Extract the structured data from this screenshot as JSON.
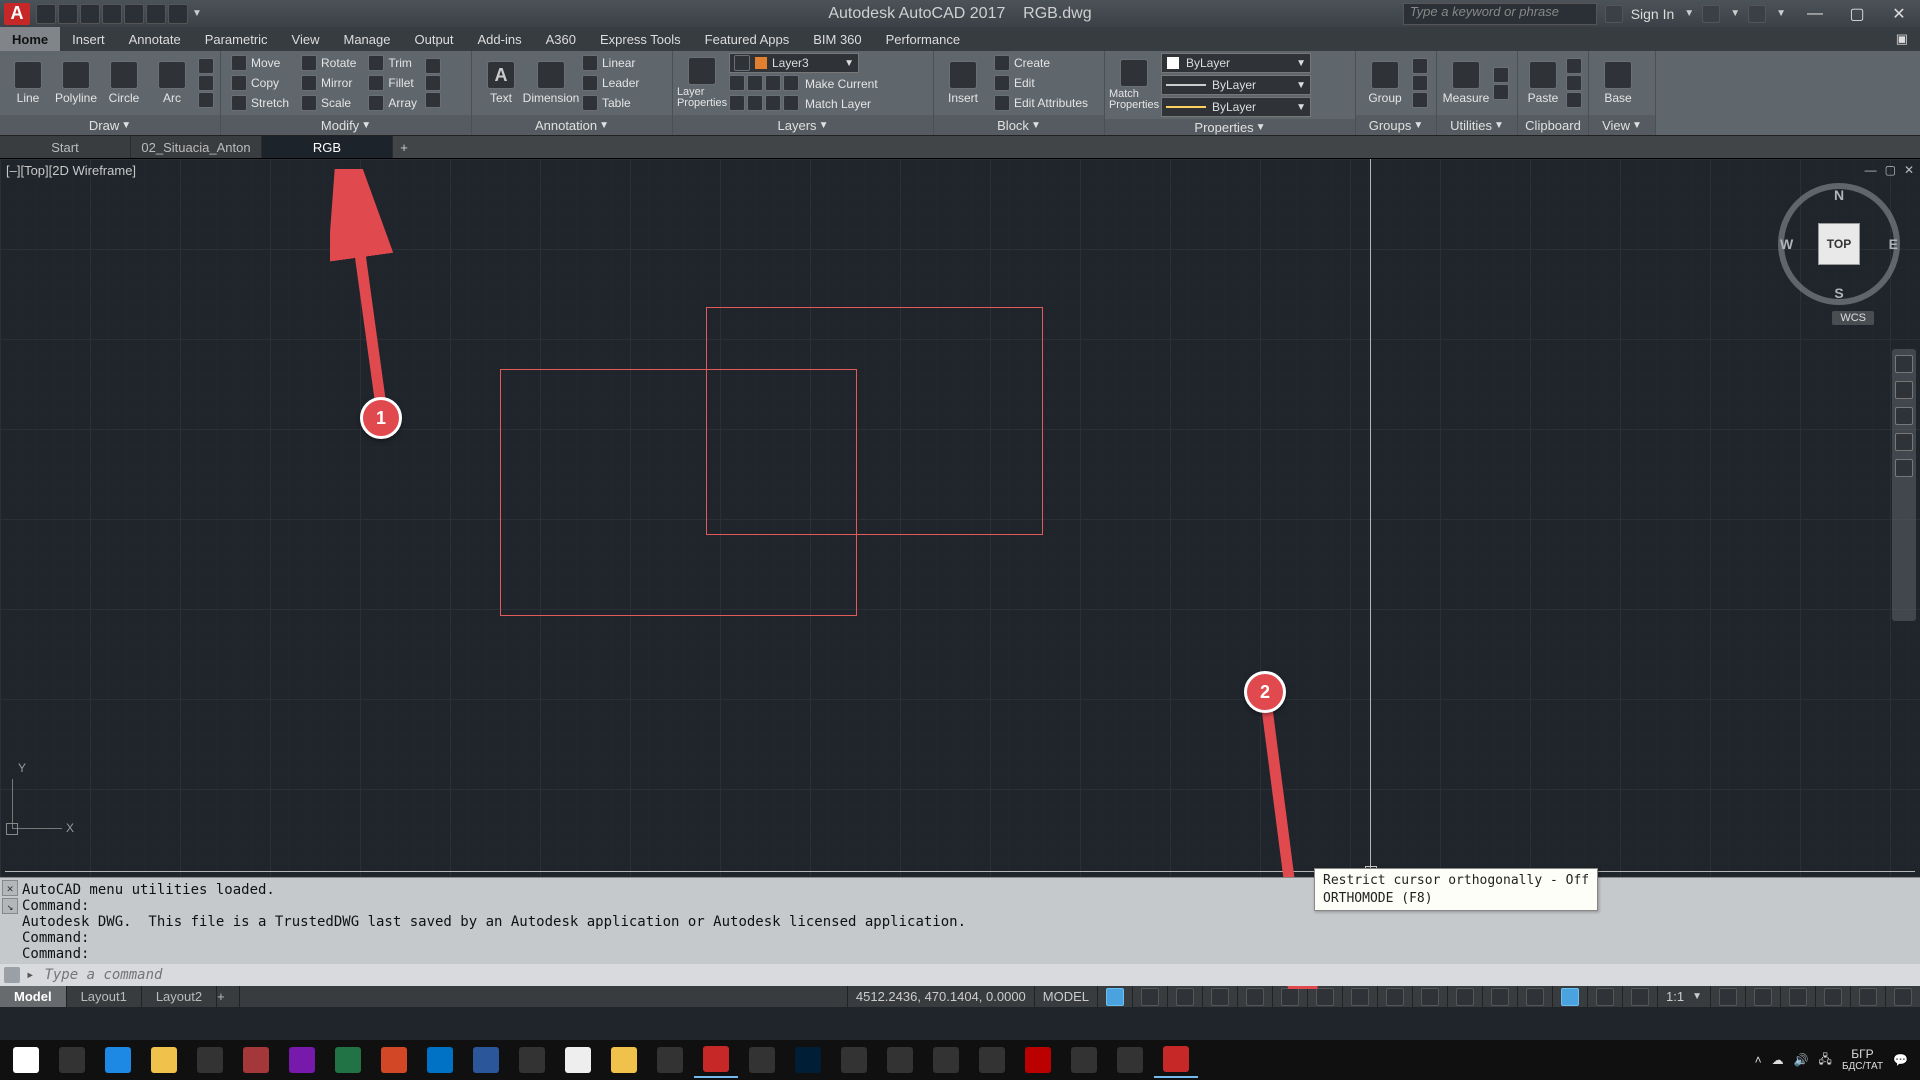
{
  "titleBar": {
    "appName": "Autodesk AutoCAD 2017",
    "fileName": "RGB.dwg",
    "searchPlaceholder": "Type a keyword or phrase",
    "signIn": "Sign In"
  },
  "menu": {
    "items": [
      "Home",
      "Insert",
      "Annotate",
      "Parametric",
      "View",
      "Manage",
      "Output",
      "Add-ins",
      "A360",
      "Express Tools",
      "Featured Apps",
      "BIM 360",
      "Performance"
    ],
    "active": 0
  },
  "ribbon": {
    "panels": [
      {
        "title": "Draw",
        "big": [
          "Line",
          "Polyline",
          "Circle",
          "Arc"
        ]
      },
      {
        "title": "Modify",
        "rows": [
          [
            "Move",
            "Rotate",
            "Trim"
          ],
          [
            "Copy",
            "Mirror",
            "Fillet"
          ],
          [
            "Stretch",
            "Scale",
            "Array"
          ]
        ]
      },
      {
        "title": "Annotation",
        "big": [
          "Text",
          "Dimension"
        ],
        "rows": [
          [
            "Linear"
          ],
          [
            "Leader"
          ],
          [
            "Table"
          ]
        ]
      },
      {
        "title": "Layers",
        "big": [
          "Layer Properties"
        ],
        "layerSel": "Layer3",
        "rows": [
          [
            ""
          ],
          [
            "Make Current"
          ],
          [
            "Match Layer"
          ]
        ]
      },
      {
        "title": "Block",
        "big": [
          "Insert"
        ],
        "rows": [
          [
            "Create"
          ],
          [
            "Edit"
          ],
          [
            "Edit Attributes"
          ]
        ]
      },
      {
        "title": "Properties",
        "big": [
          "Match Properties"
        ],
        "sel": [
          "ByLayer",
          "ByLayer",
          "ByLayer"
        ]
      },
      {
        "title": "Groups",
        "big": [
          "Group"
        ]
      },
      {
        "title": "Utilities",
        "big": [
          "Measure"
        ]
      },
      {
        "title": "Clipboard",
        "big": [
          "Paste"
        ]
      },
      {
        "title": "View",
        "big": [
          "Base"
        ]
      }
    ]
  },
  "fileTabs": {
    "tabs": [
      "Start",
      "02_Situacia_Anton",
      "RGB"
    ],
    "active": 2
  },
  "viewport": {
    "label": "[–][Top][2D Wireframe]",
    "viewCube": {
      "face": "TOP",
      "n": "N",
      "s": "S",
      "e": "E",
      "w": "W"
    },
    "wcs": "WCS",
    "ucs": {
      "x": "X",
      "y": "Y"
    }
  },
  "annotations": [
    {
      "num": "1"
    },
    {
      "num": "2"
    }
  ],
  "tooltip": {
    "line1": "Restrict cursor orthogonally - Off",
    "line2": "ORTHOMODE (F8)"
  },
  "commandLine": {
    "history": [
      "AutoCAD menu utilities loaded.",
      "Command:",
      "Autodesk DWG.  This file is a TrustedDWG last saved by an Autodesk application or Autodesk licensed application.",
      "Command:",
      "Command:",
      "Command:"
    ],
    "placeholder": "Type a command"
  },
  "layoutTabs": {
    "tabs": [
      "Model",
      "Layout1",
      "Layout2"
    ],
    "active": 0
  },
  "status": {
    "coords": "4512.2436, 470.1404, 0.0000",
    "space": "MODEL",
    "scale": "1:1"
  },
  "tray": {
    "lang1": "БГР",
    "lang2": "БДС/ТАТ"
  }
}
